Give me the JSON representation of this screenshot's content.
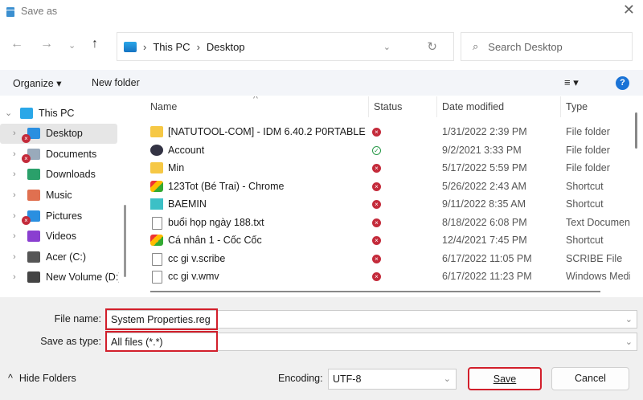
{
  "window": {
    "title": "Save as",
    "close": "✕"
  },
  "nav": {
    "back": "←",
    "forward": "→",
    "recent": "⌄",
    "up": "↑",
    "path": [
      "This PC",
      "Desktop"
    ],
    "search_placeholder": "Search Desktop"
  },
  "toolbar": {
    "organize": "Organize ▾",
    "new_folder": "New folder",
    "view": "≡ ▾",
    "help": "?"
  },
  "sidebar": {
    "items": [
      {
        "label": "This PC",
        "chev": "⌄",
        "color": "#2aa7e8",
        "badge": false
      },
      {
        "label": "Desktop",
        "chev": "›",
        "color": "#2a8fe0",
        "badge": true,
        "selected": true
      },
      {
        "label": "Documents",
        "chev": "›",
        "color": "#9ab",
        "badge": true
      },
      {
        "label": "Downloads",
        "chev": "›",
        "color": "#2aa06a",
        "badge": false
      },
      {
        "label": "Music",
        "chev": "›",
        "color": "#e07050",
        "badge": false
      },
      {
        "label": "Pictures",
        "chev": "›",
        "color": "#2a8fe0",
        "badge": true
      },
      {
        "label": "Videos",
        "chev": "›",
        "color": "#8a3fd0",
        "badge": false
      },
      {
        "label": "Acer (C:)",
        "chev": "›",
        "color": "#555",
        "badge": false
      },
      {
        "label": "New Volume (D:)",
        "chev": "›",
        "color": "#444",
        "badge": false
      }
    ]
  },
  "columns": {
    "name": "Name",
    "status": "Status",
    "date": "Date modified",
    "type": "Type",
    "sort": "^"
  },
  "files": [
    {
      "name": "[NATUTOOL-COM] - IDM 6.40.2 P0RTABLE",
      "icon": "folder",
      "status": "error",
      "date": "1/31/2022 2:39 PM",
      "type": "File folder"
    },
    {
      "name": "Account",
      "icon": "acc",
      "status": "ok",
      "date": "9/2/2021 3:33 PM",
      "type": "File folder"
    },
    {
      "name": "Min",
      "icon": "folder",
      "status": "error",
      "date": "5/17/2022 5:59 PM",
      "type": "File folder"
    },
    {
      "name": "123Tot (Bé Trai) - Chrome",
      "icon": "sc",
      "status": "error",
      "date": "5/26/2022 2:43 AM",
      "type": "Shortcut"
    },
    {
      "name": "BAEMIN",
      "icon": "bae",
      "status": "error",
      "date": "9/11/2022 8:35 AM",
      "type": "Shortcut"
    },
    {
      "name": "buổi họp ngày 188.txt",
      "icon": "file",
      "status": "error",
      "date": "8/18/2022 6:08 PM",
      "type": "Text Document"
    },
    {
      "name": "Cá nhân 1 - Cốc Cốc",
      "icon": "sc",
      "status": "error",
      "date": "12/4/2021 7:45 PM",
      "type": "Shortcut"
    },
    {
      "name": "cc gi v.scribe",
      "icon": "file",
      "status": "error",
      "date": "6/17/2022 11:05 PM",
      "type": "SCRIBE File"
    },
    {
      "name": "cc gi v.wmv",
      "icon": "file",
      "status": "error",
      "date": "6/17/2022 11:23 PM",
      "type": "Windows Media"
    }
  ],
  "form": {
    "file_name_label": "File name:",
    "file_name": "System Properties.reg",
    "type_label": "Save as type:",
    "type_value": "All files  (*.*)",
    "encoding_label": "Encoding:",
    "encoding": "UTF-8"
  },
  "buttons": {
    "hide_folders": "Hide Folders",
    "save": "Save",
    "cancel": "Cancel"
  },
  "colors": {
    "highlight": "#d21f2b",
    "accent": "#1a73d6"
  }
}
